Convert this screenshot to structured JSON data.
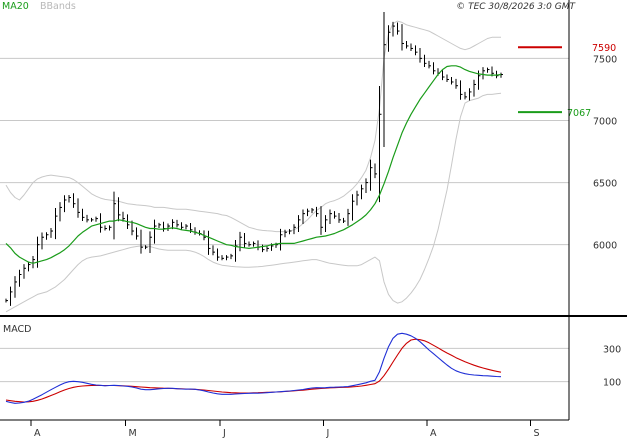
{
  "header": {
    "ma_label": "MA20",
    "bb_label": "BBands",
    "copyright": "© TEC 30/8/2026 3:0 GMT"
  },
  "colors": {
    "ma": "#1a9c1a",
    "bbands": "#c8c8c8",
    "resistance": "#cc0000",
    "support": "#1a9c1a",
    "candles": "#000000",
    "macd": "#1f2fd6",
    "signal": "#cc0000",
    "grid": "#c8c8c8",
    "frame": "#000000"
  },
  "chart_data": [
    {
      "type": "line",
      "title": "",
      "y_axis_side": "right",
      "ylim": [
        5450,
        7970
      ],
      "x_months": [
        "A",
        "M",
        "J",
        "J",
        "A",
        "S"
      ],
      "month_start_index": [
        2,
        23,
        44,
        67,
        90,
        113
      ],
      "y_ticks": [
        6000,
        6500,
        7000,
        7500
      ],
      "y_tick_labels": [
        "6000",
        "6500",
        "7000",
        "7500"
      ],
      "grid": true,
      "levels": [
        {
          "name": "resistance",
          "value": 7590,
          "label": "7590"
        },
        {
          "name": "support",
          "value": 7067,
          "label": "7067"
        }
      ],
      "series": [
        {
          "name": "price",
          "values": [
            5550,
            5620,
            5700,
            5760,
            5810,
            5840,
            5880,
            6000,
            6060,
            6080,
            6110,
            6230,
            6300,
            6360,
            6380,
            6330,
            6260,
            6220,
            6200,
            6200,
            6210,
            6140,
            6130,
            6140,
            6330,
            6240,
            6210,
            6160,
            6110,
            6070,
            5980,
            5980,
            6060,
            6150,
            6160,
            6130,
            6150,
            6180,
            6160,
            6140,
            6150,
            6120,
            6100,
            6090,
            6060,
            5970,
            5940,
            5900,
            5890,
            5900,
            5910,
            5990,
            6060,
            6010,
            6000,
            6010,
            5980,
            5960,
            5970,
            5990,
            6000,
            6080,
            6100,
            6110,
            6140,
            6200,
            6250,
            6270,
            6280,
            6250,
            6140,
            6200,
            6250,
            6230,
            6200,
            6190,
            6250,
            6350,
            6400,
            6450,
            6500,
            6620,
            6570,
            7050,
            7610,
            7710,
            7760,
            7720,
            7620,
            7600,
            7580,
            7550,
            7500,
            7460,
            7440,
            7400,
            7380,
            7350,
            7330,
            7310,
            7280,
            7210,
            7190,
            7230,
            7290,
            7360,
            7400,
            7410,
            7380,
            7360,
            7370
          ]
        },
        {
          "name": "ma20",
          "values": [
            6010,
            5975,
            5930,
            5900,
            5880,
            5860,
            5850,
            5860,
            5870,
            5880,
            5895,
            5915,
            5935,
            5960,
            5990,
            6030,
            6070,
            6100,
            6125,
            6150,
            6160,
            6170,
            6180,
            6190,
            6190,
            6200,
            6195,
            6185,
            6180,
            6170,
            6155,
            6140,
            6130,
            6130,
            6125,
            6125,
            6130,
            6135,
            6130,
            6120,
            6115,
            6110,
            6100,
            6090,
            6075,
            6060,
            6045,
            6030,
            6015,
            6000,
            5995,
            5985,
            5980,
            5975,
            5970,
            5975,
            5980,
            5985,
            5990,
            6000,
            6005,
            6010,
            6010,
            6010,
            6010,
            6020,
            6030,
            6040,
            6050,
            6060,
            6065,
            6070,
            6080,
            6090,
            6105,
            6120,
            6140,
            6160,
            6185,
            6210,
            6240,
            6280,
            6330,
            6400,
            6490,
            6590,
            6700,
            6800,
            6900,
            6980,
            7050,
            7110,
            7170,
            7220,
            7270,
            7320,
            7370,
            7410,
            7435,
            7440,
            7440,
            7430,
            7410,
            7395,
            7385,
            7375,
            7370,
            7365,
            7365,
            7365,
            7370
          ]
        },
        {
          "name": "bb_upper",
          "values": [
            6480,
            6420,
            6380,
            6360,
            6400,
            6450,
            6500,
            6530,
            6545,
            6555,
            6560,
            6555,
            6550,
            6545,
            6540,
            6525,
            6500,
            6470,
            6440,
            6410,
            6390,
            6375,
            6365,
            6360,
            6355,
            6350,
            6340,
            6330,
            6325,
            6320,
            6318,
            6315,
            6310,
            6300,
            6300,
            6300,
            6295,
            6290,
            6285,
            6285,
            6285,
            6280,
            6275,
            6270,
            6265,
            6260,
            6255,
            6250,
            6240,
            6235,
            6220,
            6200,
            6180,
            6160,
            6140,
            6130,
            6120,
            6115,
            6112,
            6110,
            6105,
            6105,
            6105,
            6110,
            6120,
            6140,
            6170,
            6200,
            6240,
            6275,
            6300,
            6330,
            6345,
            6355,
            6370,
            6390,
            6420,
            6450,
            6490,
            6540,
            6600,
            6700,
            6840,
            7100,
            7500,
            7700,
            7780,
            7800,
            7790,
            7770,
            7760,
            7750,
            7740,
            7730,
            7720,
            7700,
            7680,
            7660,
            7640,
            7620,
            7600,
            7580,
            7570,
            7580,
            7600,
            7620,
            7640,
            7660,
            7670,
            7670,
            7670
          ]
        },
        {
          "name": "bb_lower",
          "values": [
            5460,
            5480,
            5500,
            5520,
            5540,
            5560,
            5580,
            5600,
            5610,
            5620,
            5640,
            5660,
            5690,
            5720,
            5760,
            5800,
            5840,
            5870,
            5890,
            5900,
            5905,
            5910,
            5920,
            5930,
            5940,
            5950,
            5960,
            5970,
            5980,
            5985,
            5990,
            5990,
            5985,
            5975,
            5965,
            5960,
            5955,
            5955,
            5955,
            5955,
            5955,
            5950,
            5940,
            5925,
            5905,
            5880,
            5860,
            5845,
            5835,
            5830,
            5825,
            5822,
            5820,
            5818,
            5818,
            5820,
            5822,
            5825,
            5830,
            5835,
            5840,
            5845,
            5850,
            5855,
            5860,
            5865,
            5870,
            5875,
            5880,
            5880,
            5870,
            5860,
            5850,
            5845,
            5840,
            5835,
            5830,
            5830,
            5830,
            5840,
            5860,
            5880,
            5900,
            5870,
            5700,
            5600,
            5550,
            5530,
            5540,
            5570,
            5610,
            5660,
            5720,
            5800,
            5890,
            5990,
            6120,
            6280,
            6440,
            6640,
            6850,
            7030,
            7140,
            7160,
            7170,
            7180,
            7200,
            7210,
            7210,
            7215,
            7220
          ]
        }
      ]
    },
    {
      "type": "line",
      "title": "MACD",
      "y_axis_side": "right",
      "ylim": [
        -130,
        470
      ],
      "y_ticks": [
        100,
        300
      ],
      "y_tick_labels": [
        "100",
        "300"
      ],
      "grid": true,
      "series": [
        {
          "name": "macd",
          "values": [
            -18,
            -25,
            -30,
            -28,
            -24,
            -17,
            -5,
            8,
            22,
            37,
            52,
            66,
            80,
            92,
            100,
            102,
            100,
            96,
            90,
            84,
            80,
            78,
            75,
            77,
            78,
            77,
            74,
            72,
            68,
            62,
            55,
            52,
            52,
            54,
            57,
            59,
            60,
            60,
            58,
            56,
            55,
            56,
            54,
            50,
            45,
            38,
            32,
            27,
            24,
            24,
            24,
            26,
            28,
            29,
            30,
            31,
            31,
            32,
            34,
            36,
            38,
            40,
            42,
            44,
            47,
            50,
            53,
            58,
            62,
            64,
            63,
            64,
            66,
            67,
            68,
            69,
            71,
            76,
            81,
            87,
            93,
            102,
            108,
            160,
            240,
            310,
            360,
            385,
            390,
            385,
            375,
            360,
            340,
            315,
            290,
            268,
            245,
            222,
            200,
            180,
            165,
            155,
            148,
            143,
            140,
            138,
            136,
            135,
            133,
            131,
            130
          ]
        },
        {
          "name": "signal",
          "values": [
            -10,
            -14,
            -18,
            -20,
            -22,
            -21,
            -18,
            -12,
            -4,
            6,
            17,
            28,
            39,
            50,
            59,
            66,
            71,
            74,
            76,
            77,
            77,
            77,
            77,
            77,
            77,
            76,
            75,
            74,
            72,
            70,
            68,
            66,
            64,
            63,
            62,
            61,
            60,
            59,
            58,
            57,
            56,
            55,
            54,
            52,
            50,
            47,
            44,
            41,
            38,
            36,
            34,
            33,
            32,
            32,
            32,
            33,
            34,
            35,
            36,
            37,
            38,
            39,
            41,
            43,
            45,
            47,
            49,
            52,
            55,
            57,
            59,
            61,
            63,
            64,
            65,
            66,
            67,
            69,
            71,
            74,
            78,
            83,
            88,
            104,
            136,
            175,
            218,
            260,
            300,
            330,
            350,
            355,
            352,
            345,
            333,
            318,
            303,
            287,
            272,
            258,
            244,
            232,
            220,
            209,
            199,
            190,
            182,
            175,
            168,
            162,
            157
          ]
        }
      ]
    }
  ]
}
